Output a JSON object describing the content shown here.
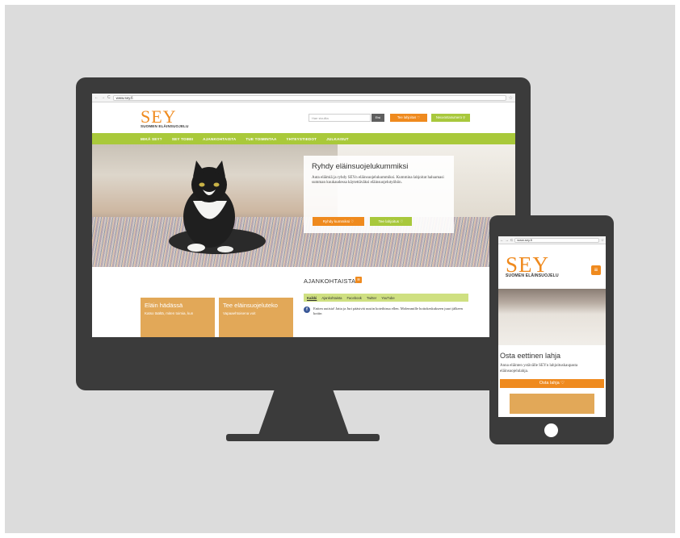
{
  "desktop": {
    "browser": {
      "back_icon": "←",
      "forward_icon": "→",
      "reload_icon": "C",
      "url": "www.sey.fi",
      "star_icon": "☆"
    },
    "header": {
      "logo_main": "SEY",
      "logo_sub": "SUOMEN ELÄINSUOJELU",
      "search_placeholder": "Hae sivuilta",
      "search_button": "Etsi",
      "donate_button": "Tee lahjoitus ♡",
      "find_button": "Neuvontanumero ⚲"
    },
    "nav": {
      "items": [
        "MIKÄ SEY?",
        "SEY TOIMII",
        "AJANKOHTAISTA",
        "TUE TOIMINTAA",
        "YHTEYSTIEDOT",
        "JULKAISUT"
      ]
    },
    "hero": {
      "title": "Ryhdy eläinsuojelukummiksi",
      "text": "Auta eläimiä ja ryhdy SEYn eläinsuojelukummiksi. Kummina lahjoitat haluamasi summan kuukaudessa käytettäväksi eläinsuojelutyöhön.",
      "button_primary": "Ryhdy kummiksi ♡",
      "button_secondary": "Tee lahjoitus ♡"
    },
    "news": {
      "title": "AJANKOHTAISTA",
      "rss_icon": "≋",
      "tabs": [
        "Kaikki",
        "Ajankohtaista",
        "Facebook",
        "Twitter",
        "YouTube"
      ],
      "item_icon": "f",
      "item_text": "Eniten uutisia! Jatta ja Juri pääsivät uusiin koteihinsa ellen. Molemmille hoitokeskukseen juuri jälkeen kotiin"
    },
    "cards": [
      {
        "title": "Eläin hädässä",
        "text": "Katso täältä, miten toimia, kun"
      },
      {
        "title": "Tee eläinsuojeluteko",
        "text": "Vapaaehtoisena voit"
      }
    ]
  },
  "mobile": {
    "browser": {
      "back_icon": "←",
      "forward_icon": "→",
      "reload_icon": "C",
      "url": "www.sey.fi",
      "star_icon": "☆"
    },
    "logo_main": "SEY",
    "logo_sub": "SUOMEN ELÄINSUOJELU",
    "menu_icon": "≡",
    "title": "Osta eettinen lahja",
    "text": "Anna eläinten ystävälle SEYn lahjoituskaupasta eläinsuojelulahja.",
    "button": "Osta lahja ♡"
  }
}
